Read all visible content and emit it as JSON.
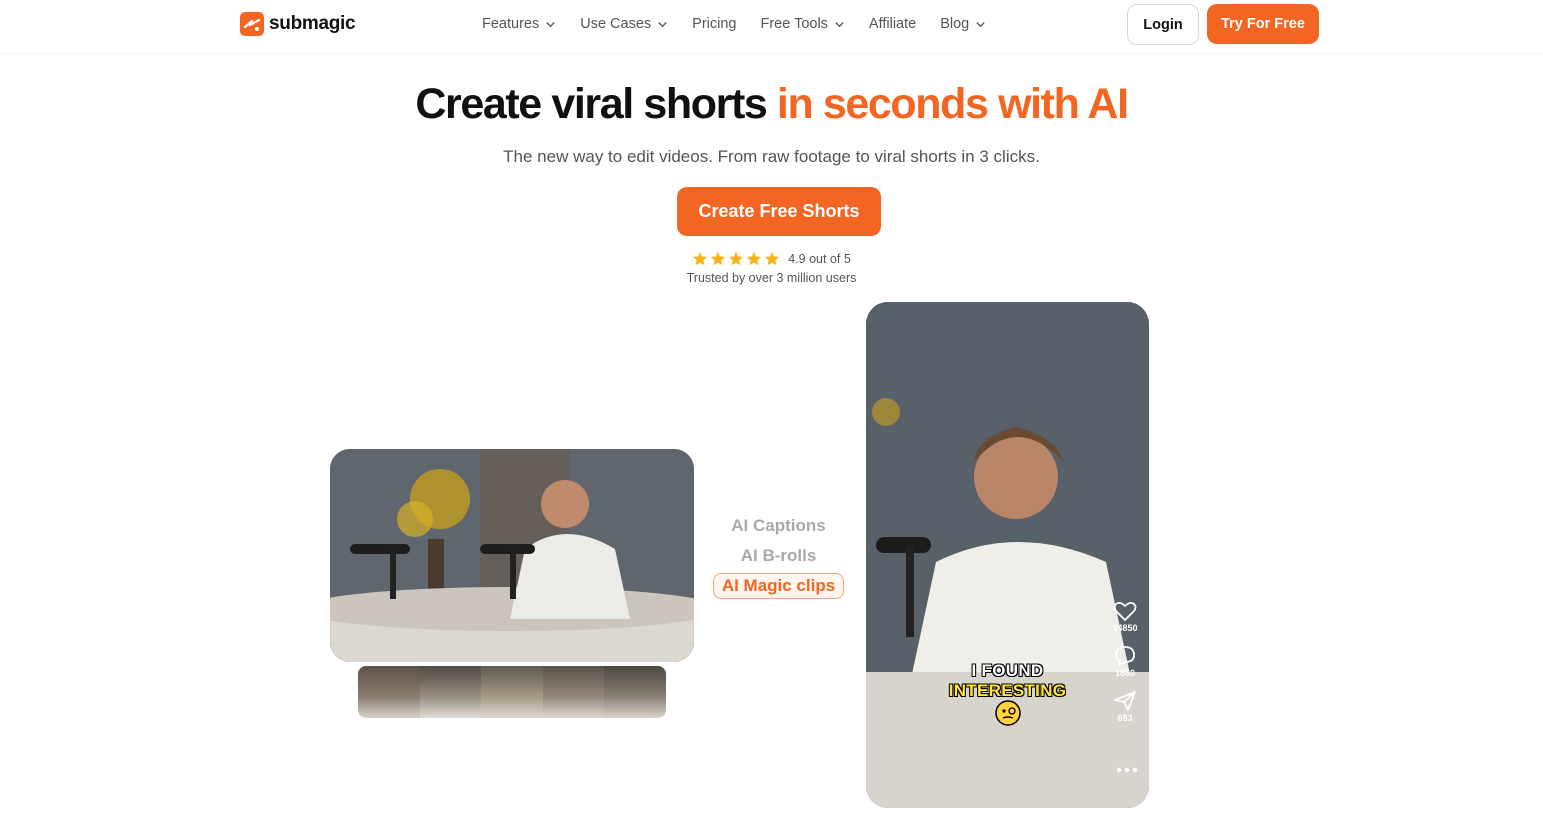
{
  "brand": {
    "name": "submagic",
    "accent_color": "#f26522"
  },
  "nav": {
    "links": [
      {
        "label": "Features",
        "dropdown": true
      },
      {
        "label": "Use Cases",
        "dropdown": true
      },
      {
        "label": "Pricing",
        "dropdown": false
      },
      {
        "label": "Free Tools",
        "dropdown": true
      },
      {
        "label": "Affiliate",
        "dropdown": false
      },
      {
        "label": "Blog",
        "dropdown": true
      }
    ],
    "login_label": "Login",
    "try_label": "Try For Free"
  },
  "hero": {
    "title_main": "Create viral shorts ",
    "title_accent": "in seconds with AI",
    "subtitle": "The new way to edit videos. From raw footage to viral shorts in 3 clicks.",
    "cta_label": "Create Free Shorts",
    "rating_text": "4.9 out of 5",
    "rating_stars": 5,
    "trusted_text": "Trusted by over 3 million users"
  },
  "features": [
    "AI Captions",
    "AI B-rolls",
    "AI Magic clips"
  ],
  "phone": {
    "caption_line1": "I FOUND",
    "caption_line2": "INTERESTING",
    "likes": "14850",
    "comments": "1860",
    "shares": "693"
  }
}
